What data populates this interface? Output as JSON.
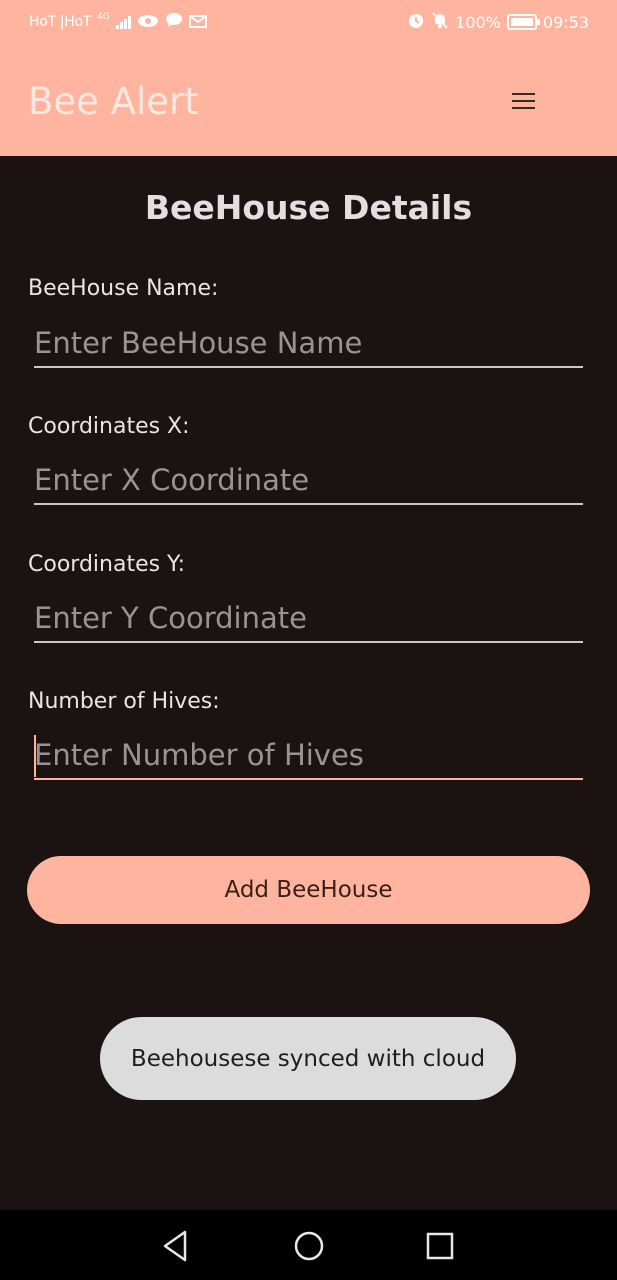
{
  "status_bar": {
    "carrier": "HoT |HoT",
    "network": "4G",
    "battery_text": "100%",
    "time": "09:53",
    "icons": [
      "signal-icon",
      "eye-icon",
      "chat-icon",
      "mail-icon",
      "alarm-icon",
      "mute-icon",
      "battery-icon"
    ]
  },
  "app_bar": {
    "title": "Bee Alert",
    "menu_icon": "hamburger-menu-icon",
    "background": "#ffb49f"
  },
  "form": {
    "title": "BeeHouse Details",
    "fields": [
      {
        "label": "BeeHouse Name:",
        "value": "",
        "placeholder": "Enter BeeHouse Name"
      },
      {
        "label": "Coordinates X:",
        "value": "",
        "placeholder": "Enter X Coordinate"
      },
      {
        "label": "Coordinates Y:",
        "value": "",
        "placeholder": "Enter Y Coordinate"
      },
      {
        "label": "Number of Hives:",
        "value": "",
        "placeholder": "Enter Number of Hives",
        "focused": true
      }
    ],
    "submit_label": "Add BeeHouse"
  },
  "toast": {
    "message": "Beehousese synced with cloud"
  },
  "nav_bar": {
    "buttons": [
      "back-icon",
      "home-icon",
      "recents-icon"
    ]
  },
  "colors": {
    "accent": "#ffb49f",
    "background": "#1b1212",
    "toast_bg": "#dcdcdc"
  }
}
